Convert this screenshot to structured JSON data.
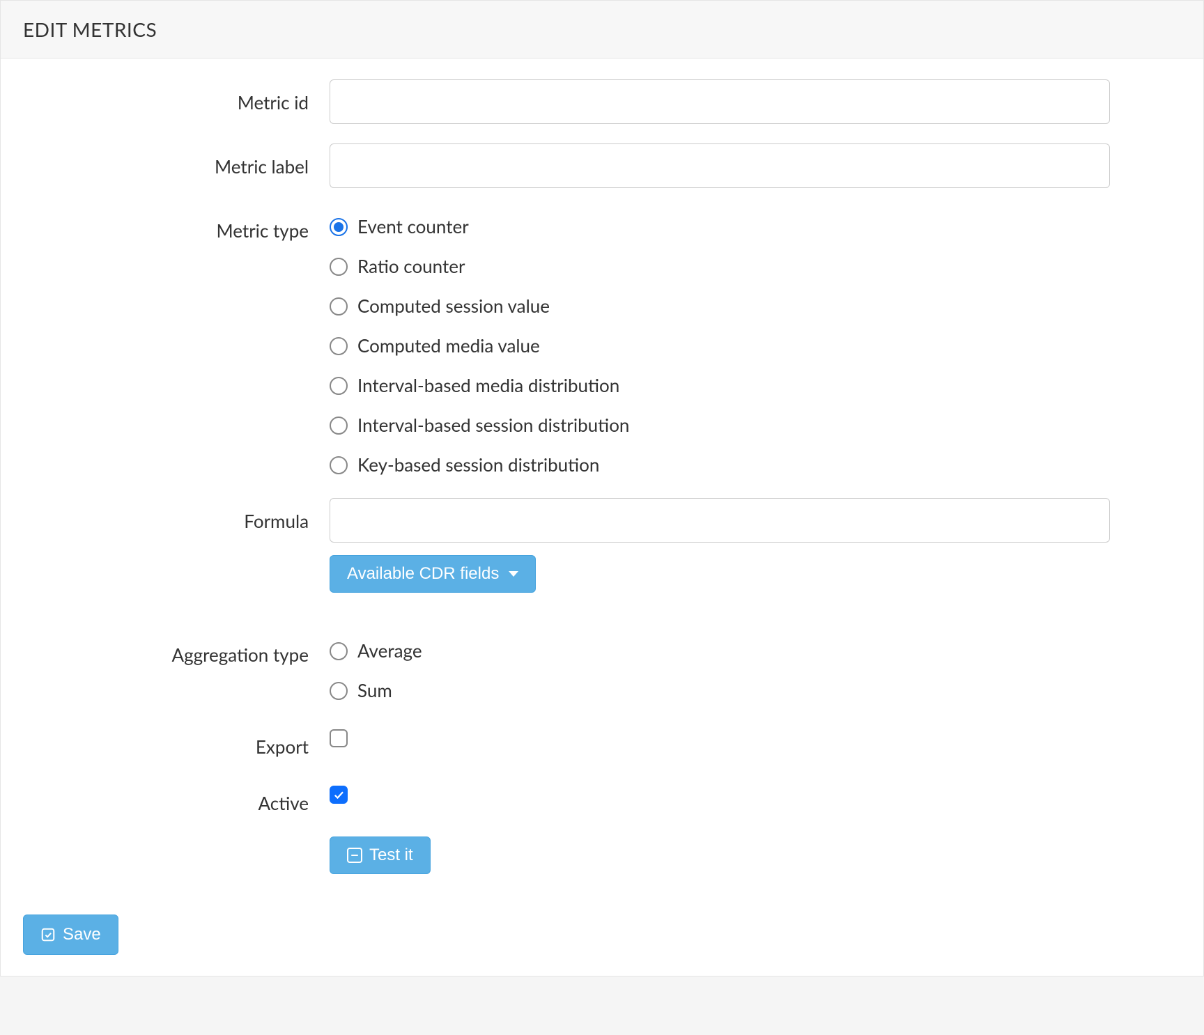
{
  "header": {
    "title": "EDIT METRICS"
  },
  "form": {
    "metric_id": {
      "label": "Metric id",
      "value": ""
    },
    "metric_label": {
      "label": "Metric label",
      "value": ""
    },
    "metric_type": {
      "label": "Metric type",
      "selected_index": 0,
      "options": [
        "Event counter",
        "Ratio counter",
        "Computed session value",
        "Computed media value",
        "Interval-based media distribution",
        "Interval-based session distribution",
        "Key-based session distribution"
      ]
    },
    "formula": {
      "label": "Formula",
      "value": ""
    },
    "cdr_button": {
      "label": "Available CDR fields"
    },
    "aggregation_type": {
      "label": "Aggregation type",
      "selected_index": -1,
      "options": [
        "Average",
        "Sum"
      ]
    },
    "export": {
      "label": "Export",
      "checked": false
    },
    "active": {
      "label": "Active",
      "checked": true
    },
    "test_button": {
      "label": "Test it"
    }
  },
  "footer": {
    "save_label": "Save"
  }
}
